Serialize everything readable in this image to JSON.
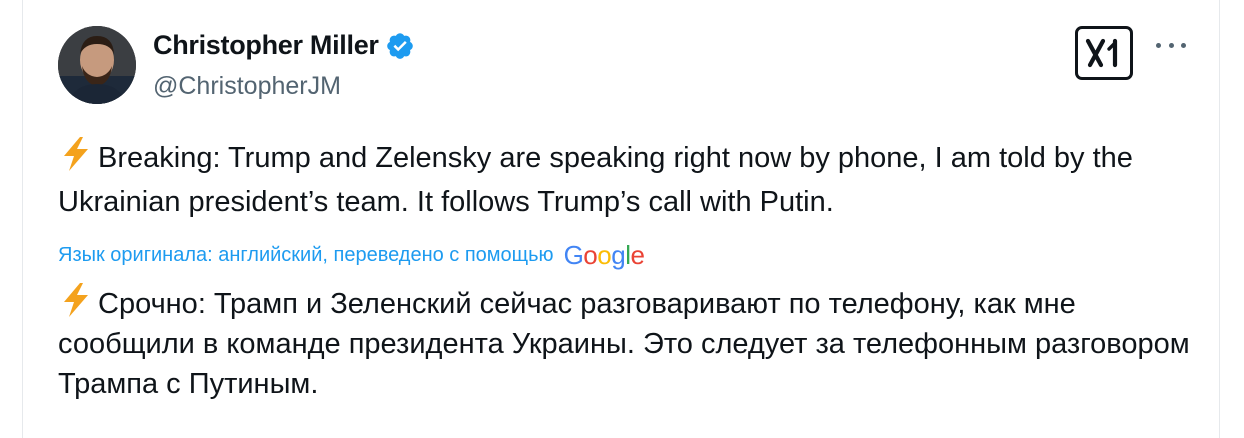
{
  "author": {
    "name": "Christopher Miller",
    "handle": "@ChristopherJM",
    "verified": true
  },
  "icons": {
    "verified": "verified-badge-icon",
    "platform": "x-logo-icon",
    "more": "more-options-icon",
    "emoji": "lightning-bolt-emoji"
  },
  "tweet": {
    "original_text": "Breaking: Trump and Zelensky are speaking right now by phone, I am told by the Ukrainian president’s team. It follows Trump’s call with Putin.",
    "translation_notice": "Язык оригинала: английский, переведено с помощью",
    "translation_provider": "Google",
    "translated_text": "Срочно: Трамп и Зеленский сейчас разговаривают по телефону, как мне сообщили в команде президента Украины. Это следует за телефонным разговором Трампа с Путиным."
  },
  "colors": {
    "verified": "#1d9bf0",
    "link": "#1d9bf0",
    "text": "#0f1419",
    "secondary": "#536471",
    "google_blue": "#4285F4",
    "google_red": "#EA4335",
    "google_yellow": "#FBBC05",
    "google_green": "#34A853"
  }
}
